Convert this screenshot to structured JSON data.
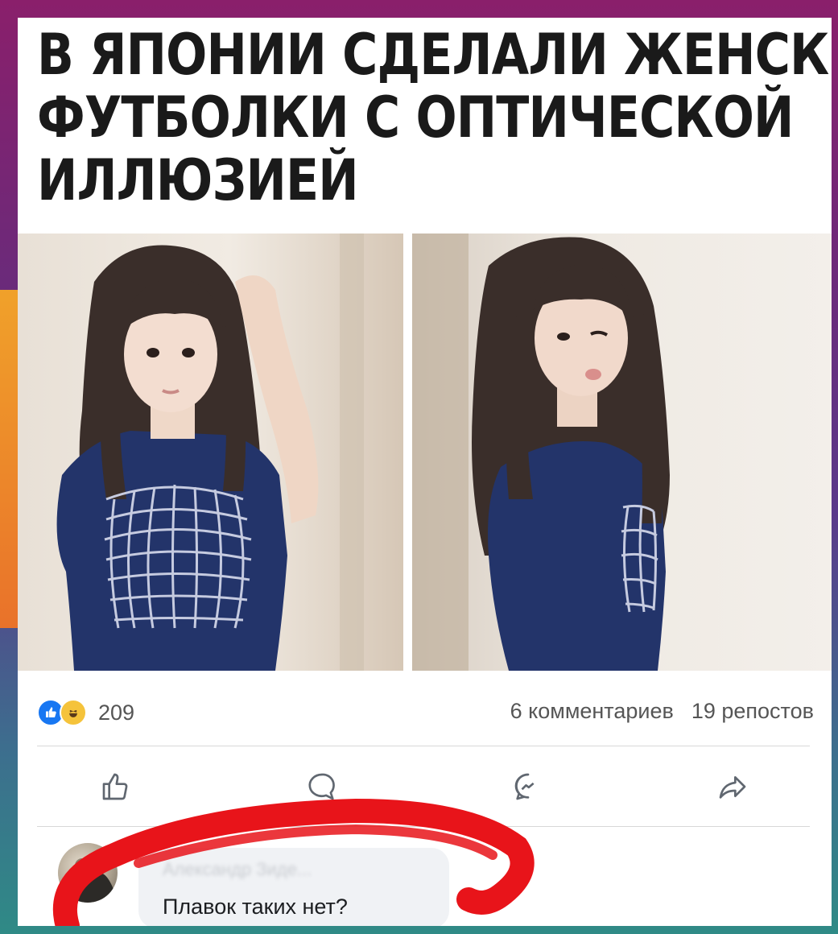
{
  "post": {
    "headline": [
      "В ЯПОНИИ СДЕЛАЛИ ЖЕНСКИЕ",
      "ФУТБОЛКИ С ОПТИЧЕСКОЙ",
      "ИЛЛЮЗИЕЙ"
    ]
  },
  "reactions": {
    "icons": [
      "like-icon",
      "haha-icon"
    ],
    "count": "209"
  },
  "stats": {
    "comments": "6 комментариев",
    "shares": "19 репостов"
  },
  "actions": [
    "like-icon",
    "comment-icon",
    "messenger-icon",
    "share-icon"
  ],
  "comment": {
    "author": "Александр Зиде...",
    "text": "Плавок таких нет?"
  },
  "colors": {
    "card": "#ffffff",
    "headline": "#1a1a1a",
    "shirt": "#23346a",
    "grid": "#c6cbe0",
    "annotation": "#e8141a",
    "bubble": "#f0f2f5"
  }
}
